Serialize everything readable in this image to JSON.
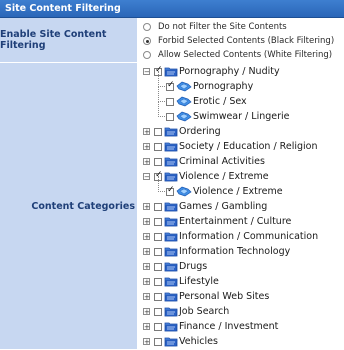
{
  "header": {
    "title": "Site Content Filtering"
  },
  "filter": {
    "label": "Enable Site Content Filtering",
    "options": [
      {
        "label": "Do not Filter the Site Contents",
        "selected": false
      },
      {
        "label": "Forbid Selected Contents (Black Filtering)",
        "selected": true
      },
      {
        "label": "Allow Selected Contents (White Filtering)",
        "selected": false
      }
    ]
  },
  "categories": {
    "label": "Content Categories",
    "items": [
      {
        "label": "Pornography / Nudity",
        "expanded": true,
        "checked": true,
        "children": [
          {
            "label": "Pornography",
            "checked": true
          },
          {
            "label": "Erotic / Sex",
            "checked": false
          },
          {
            "label": "Swimwear / Lingerie",
            "checked": false
          }
        ]
      },
      {
        "label": "Ordering",
        "expanded": false,
        "checked": false
      },
      {
        "label": "Society / Education / Religion",
        "expanded": false,
        "checked": false
      },
      {
        "label": "Criminal Activities",
        "expanded": false,
        "checked": false
      },
      {
        "label": "Violence / Extreme",
        "expanded": true,
        "checked": true,
        "children": [
          {
            "label": "Violence / Extreme",
            "checked": true
          }
        ]
      },
      {
        "label": "Games / Gambling",
        "expanded": false,
        "checked": false
      },
      {
        "label": "Entertainment / Culture",
        "expanded": false,
        "checked": false
      },
      {
        "label": "Information / Communication",
        "expanded": false,
        "checked": false
      },
      {
        "label": "Information Technology",
        "expanded": false,
        "checked": false
      },
      {
        "label": "Drugs",
        "expanded": false,
        "checked": false
      },
      {
        "label": "Lifestyle",
        "expanded": false,
        "checked": false
      },
      {
        "label": "Personal Web Sites",
        "expanded": false,
        "checked": false
      },
      {
        "label": "Job Search",
        "expanded": false,
        "checked": false
      },
      {
        "label": "Finance / Investment",
        "expanded": false,
        "checked": false
      },
      {
        "label": "Vehicles",
        "expanded": false,
        "checked": false
      }
    ]
  },
  "icons": {
    "folder": "folder-icon",
    "page": "web-page-icon",
    "expand": "expand-icon",
    "collapse": "collapse-icon"
  },
  "colors": {
    "header": "#2f6fc4",
    "label_bg": "#c7d7f1",
    "label_text": "#1f3f78",
    "icon": "#2a62c8"
  }
}
